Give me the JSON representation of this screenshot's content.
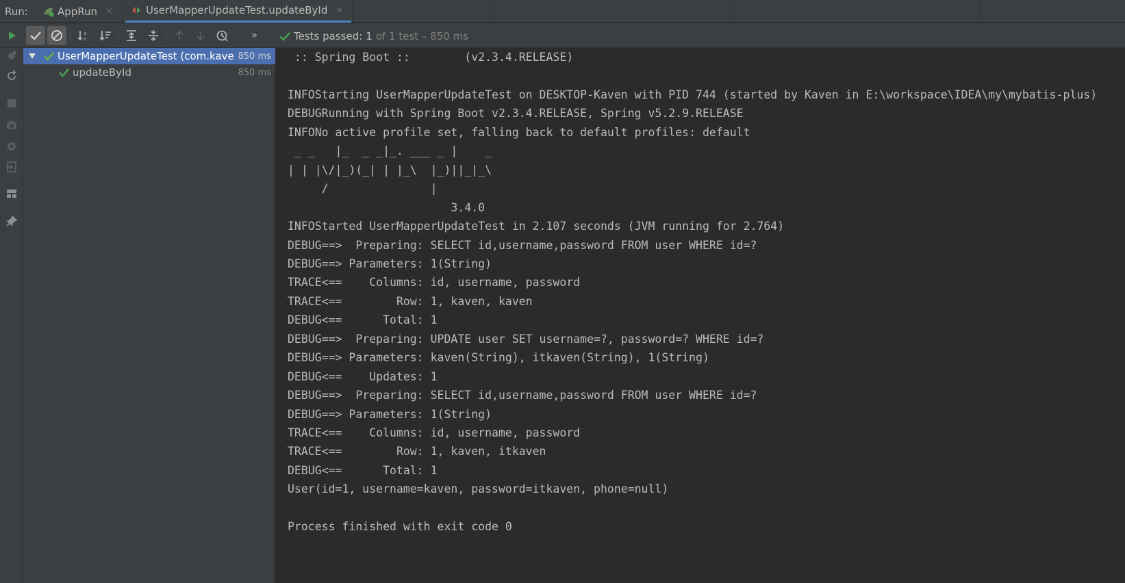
{
  "run_bar": {
    "label": "Run:",
    "tabs": [
      {
        "label": "AppRun",
        "close": "×"
      },
      {
        "label": "UserMapperUpdateTest.updateById",
        "close": "×"
      }
    ]
  },
  "toolbar": {
    "status_passed": "Tests passed:",
    "status_count": "1",
    "status_rest": "of 1 test – 850 ms",
    "more": "»"
  },
  "tree": {
    "root": {
      "label": "UserMapperUpdateTest (com.kaver",
      "duration": "850 ms"
    },
    "child": {
      "label": "updateById",
      "duration": "850 ms"
    }
  },
  "console": {
    "lines": [
      " :: Spring Boot ::        (v2.3.4.RELEASE)",
      "",
      "INFOStarting UserMapperUpdateTest on DESKTOP-Kaven with PID 744 (started by Kaven in E:\\workspace\\IDEA\\my\\mybatis-plus)",
      "DEBUGRunning with Spring Boot v2.3.4.RELEASE, Spring v5.2.9.RELEASE",
      "INFONo active profile set, falling back to default profiles: default",
      " _ _   |_  _ _|_. ___ _ |    _",
      "| | |\\/|_)(_| | |_\\  |_)||_|_\\",
      "     /               |",
      "                        3.4.0",
      "INFOStarted UserMapperUpdateTest in 2.107 seconds (JVM running for 2.764)",
      "DEBUG==>  Preparing: SELECT id,username,password FROM user WHERE id=?",
      "DEBUG==> Parameters: 1(String)",
      "TRACE<==    Columns: id, username, password",
      "TRACE<==        Row: 1, kaven, kaven",
      "DEBUG<==      Total: 1",
      "DEBUG==>  Preparing: UPDATE user SET username=?, password=? WHERE id=?",
      "DEBUG==> Parameters: kaven(String), itkaven(String), 1(String)",
      "DEBUG<==    Updates: 1",
      "DEBUG==>  Preparing: SELECT id,username,password FROM user WHERE id=?",
      "DEBUG==> Parameters: 1(String)",
      "TRACE<==    Columns: id, username, password",
      "TRACE<==        Row: 1, kaven, itkaven",
      "DEBUG<==      Total: 1",
      "User(id=1, username=kaven, password=itkaven, phone=null)",
      "",
      "Process finished with exit code 0"
    ]
  },
  "colors": {
    "accent_tab": "#4a88c7",
    "passed_green": "#499c54",
    "selection": "#4b6eaf"
  }
}
